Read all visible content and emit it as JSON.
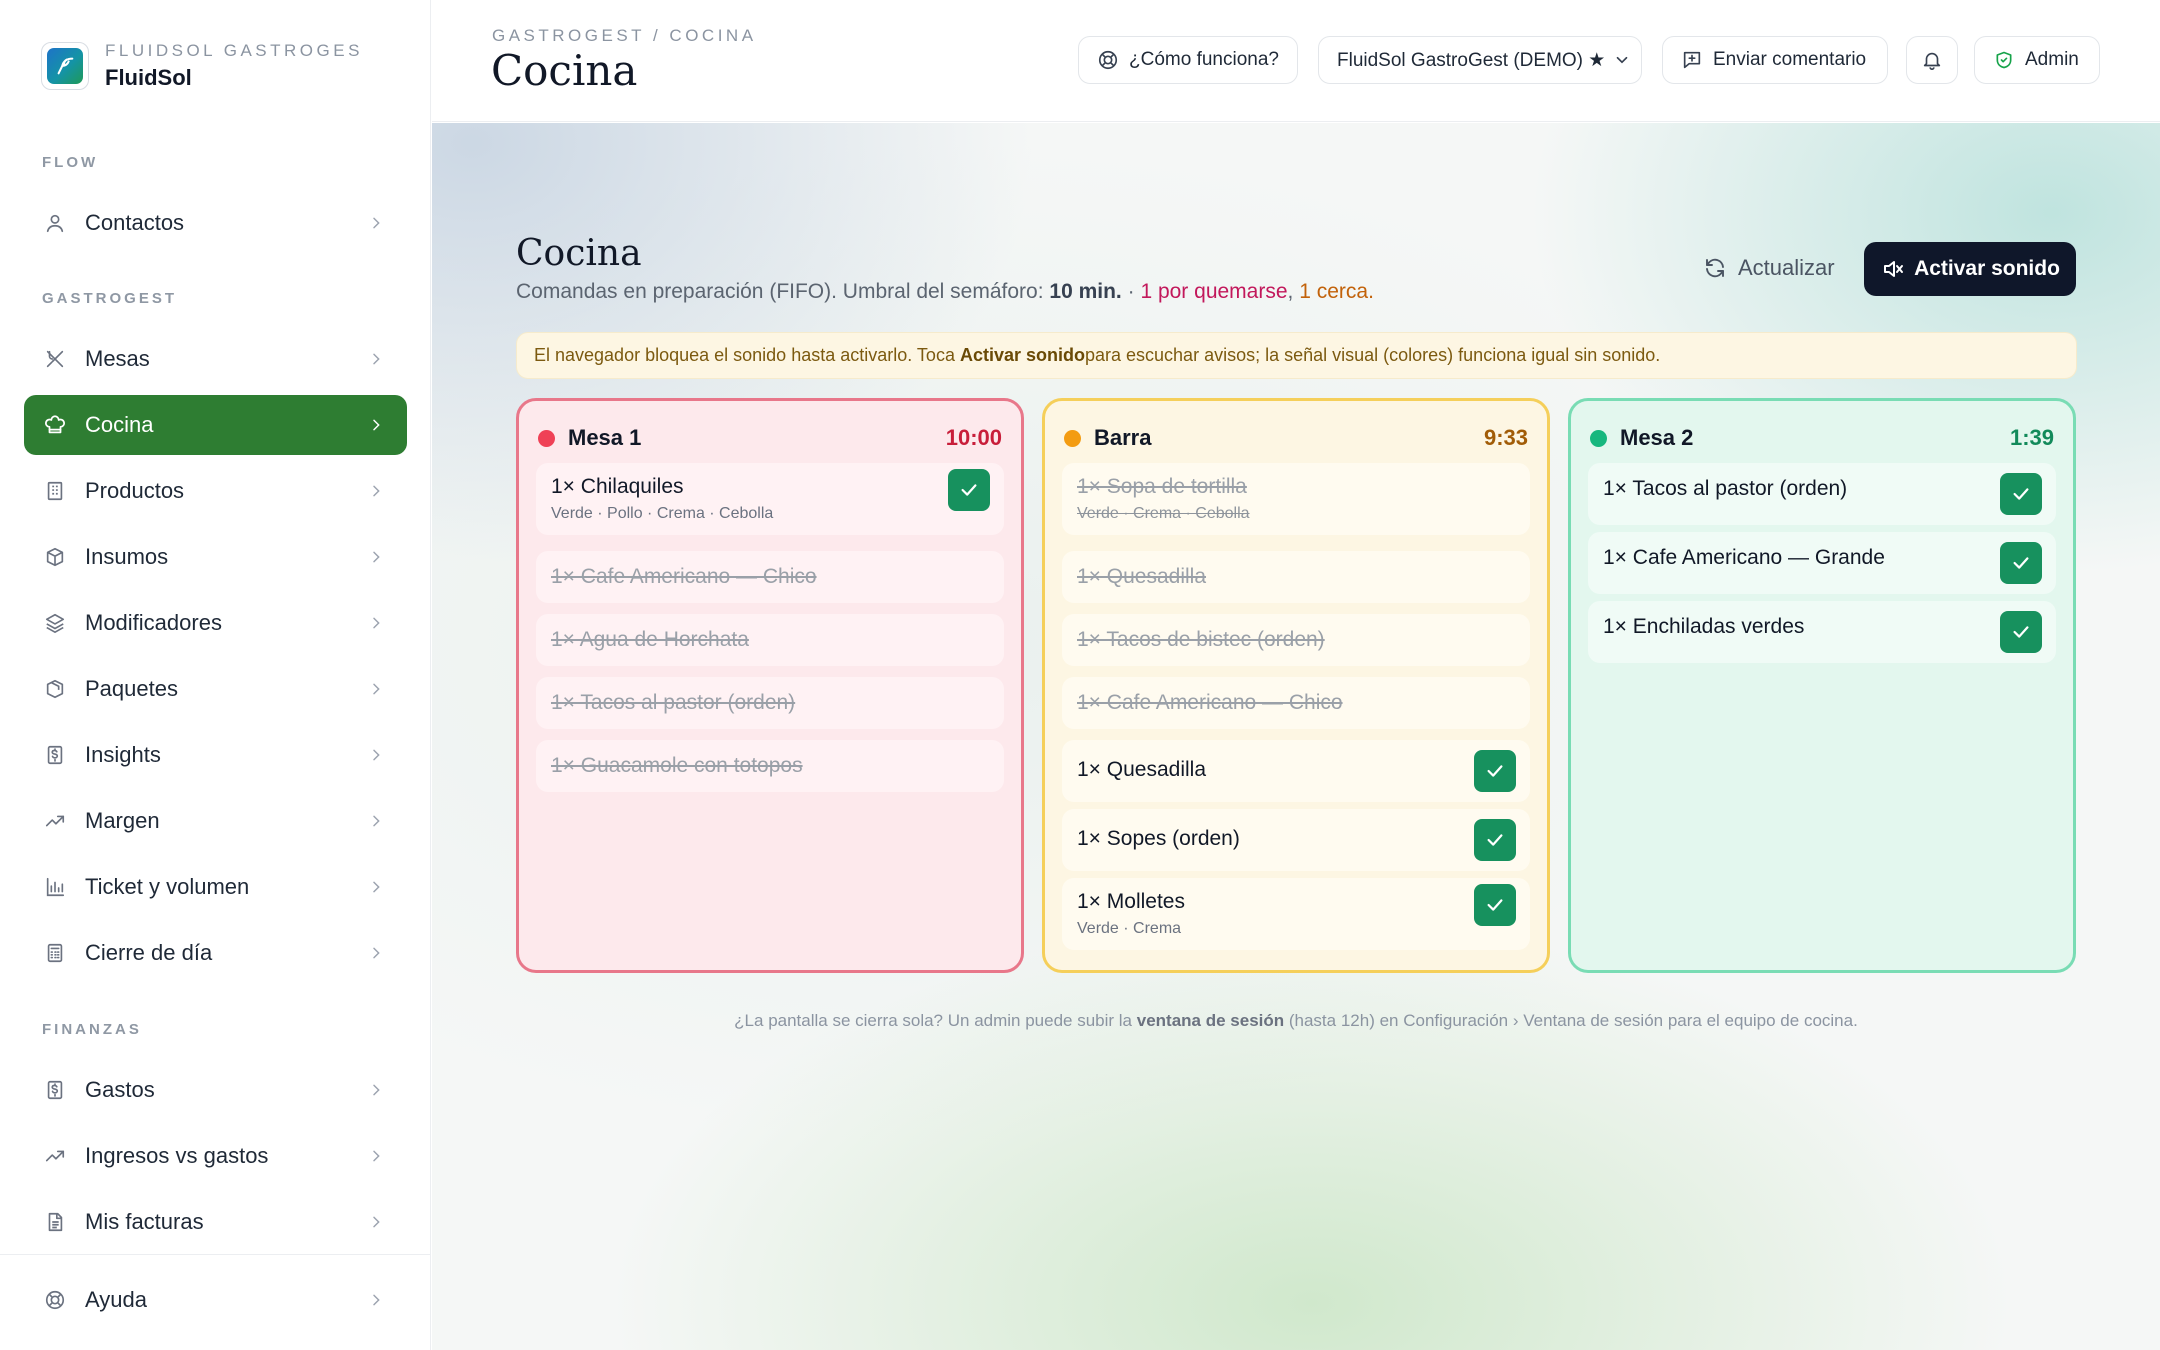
{
  "brand": {
    "subtitle": "FLUIDSOL GASTROGES",
    "name": "FluidSol"
  },
  "sidebar": {
    "sections": [
      {
        "title": "FLOW",
        "items": [
          {
            "label": "Contactos",
            "icon": "user-icon"
          }
        ]
      },
      {
        "title": "GASTROGEST",
        "items": [
          {
            "label": "Mesas",
            "icon": "utensils-icon"
          },
          {
            "label": "Cocina",
            "icon": "chef-hat-icon",
            "active": true
          },
          {
            "label": "Productos",
            "icon": "building-icon"
          },
          {
            "label": "Insumos",
            "icon": "boxes-icon"
          },
          {
            "label": "Modificadores",
            "icon": "layers-icon"
          },
          {
            "label": "Paquetes",
            "icon": "package-icon"
          },
          {
            "label": "Insights",
            "icon": "dollar-receipt-icon"
          },
          {
            "label": "Margen",
            "icon": "trend-up-icon"
          },
          {
            "label": "Ticket y volumen",
            "icon": "bar-chart-icon"
          },
          {
            "label": "Cierre de día",
            "icon": "calculator-icon"
          }
        ]
      },
      {
        "title": "FINANZAS",
        "items": [
          {
            "label": "Gastos",
            "icon": "dollar-receipt-icon"
          },
          {
            "label": "Ingresos vs gastos",
            "icon": "trend-up-icon"
          },
          {
            "label": "Mis facturas",
            "icon": "file-icon"
          }
        ]
      }
    ],
    "footer_item": {
      "label": "Ayuda",
      "icon": "lifebuoy-icon"
    }
  },
  "header": {
    "breadcrumb": "GASTROGEST / COCINA",
    "title": "Cocina",
    "how_it_works": "¿Cómo funciona?",
    "workspace": "FluidSol GastroGest (DEMO) ★",
    "feedback": "Enviar comentario",
    "admin": "Admin"
  },
  "main": {
    "title": "Cocina",
    "subtitle_prefix": "Comandas en preparación (FIFO). Umbral del semáforo: ",
    "threshold": "10 min.",
    "subtitle_sep": " · ",
    "burning": "1 por quemarse",
    "comma": ", ",
    "near": "1 cerca.",
    "refresh": "Actualizar",
    "sound": "Activar sonido",
    "notice_prefix": "El navegador bloquea el sonido hasta activarlo. Toca ",
    "notice_bold": "Activar sonido",
    "notice_suffix": " para escuchar avisos; la señal visual (colores) funciona igual sin sonido.",
    "footer_prefix": "¿La pantalla se cierra sola? Un admin puede subir la ",
    "footer_bold": "ventana de sesión",
    "footer_suffix": " (hasta 12h) en Configuración › Ventana de sesión para el equipo de cocina."
  },
  "colors": {
    "accent": "#2e7d32",
    "dark_button": "#0f172a",
    "check": "#17915e",
    "red": "#e8778a",
    "yellow": "#f5cf5a",
    "green": "#79dcb4"
  },
  "orders": [
    {
      "name": "Mesa 1",
      "time": "10:00",
      "status": "red",
      "dot": "#ef4156",
      "items": [
        {
          "text": "1× Chilaquiles",
          "mods": "Verde · Pollo · Crema · Cebolla",
          "done": false
        },
        {
          "text": "1× Cafe Americano — Chico",
          "done": true
        },
        {
          "text": "1× Agua de Horchata",
          "done": true
        },
        {
          "text": "1× Tacos al pastor (orden)",
          "done": true
        },
        {
          "text": "1× Guacamole con totopos",
          "done": true
        }
      ]
    },
    {
      "name": "Barra",
      "time": "9:33",
      "status": "yellow",
      "dot": "#f39c12",
      "items": [
        {
          "text": "1× Sopa de tortilla",
          "mods": "Verde · Crema · Cebolla",
          "done": true
        },
        {
          "text": "1× Quesadilla",
          "done": true
        },
        {
          "text": "1× Tacos de bistec (orden)",
          "done": true
        },
        {
          "text": "1× Cafe Americano — Chico",
          "done": true
        },
        {
          "text": "1× Quesadilla",
          "done": false
        },
        {
          "text": "1× Sopes (orden)",
          "done": false
        },
        {
          "text": "1× Molletes",
          "mods": "Verde · Crema",
          "done": false
        }
      ]
    },
    {
      "name": "Mesa 2",
      "time": "1:39",
      "status": "green",
      "dot": "#17b77e",
      "items": [
        {
          "text": "1× Tacos al pastor (orden)",
          "done": false
        },
        {
          "text": "1× Cafe Americano — Grande",
          "done": false
        },
        {
          "text": "1× Enchiladas verdes",
          "done": false
        }
      ]
    }
  ]
}
